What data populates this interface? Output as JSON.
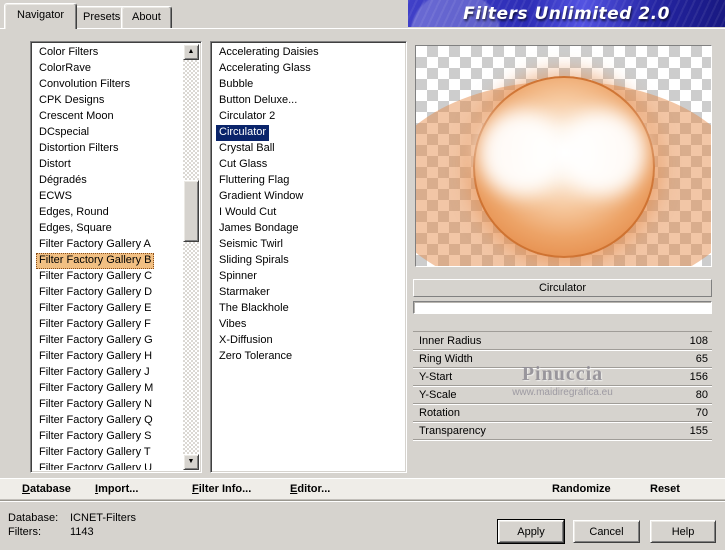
{
  "window": {
    "banner_title": "Filters Unlimited 2.0",
    "tabs": [
      "Navigator",
      "Presets",
      "About"
    ]
  },
  "categories": {
    "selected_index": 13,
    "items": [
      "Color Filters",
      "ColorRave",
      "Convolution Filters",
      "CPK Designs",
      "Crescent Moon",
      "DCspecial",
      "Distortion Filters",
      "Distort",
      "Dégradés",
      "ECWS",
      "Edges, Round",
      "Edges, Square",
      "Filter Factory Gallery A",
      "Filter Factory Gallery B",
      "Filter Factory Gallery C",
      "Filter Factory Gallery D",
      "Filter Factory Gallery E",
      "Filter Factory Gallery F",
      "Filter Factory Gallery G",
      "Filter Factory Gallery H",
      "Filter Factory Gallery J",
      "Filter Factory Gallery M",
      "Filter Factory Gallery N",
      "Filter Factory Gallery Q",
      "Filter Factory Gallery S",
      "Filter Factory Gallery T",
      "Filter Factory Gallery U"
    ]
  },
  "filters_list": {
    "selected_index": 5,
    "items": [
      "Accelerating Daisies",
      "Accelerating Glass",
      "Bubble",
      "Button Deluxe...",
      "Circulator 2",
      "Circulator",
      "Crystal Ball",
      "Cut Glass",
      "Fluttering Flag",
      "Gradient Window",
      "I Would Cut",
      "James Bondage",
      "Seismic Twirl",
      "Sliding Spirals",
      "Spinner",
      "Starmaker",
      "The Blackhole",
      "Vibes",
      "X-Diffusion",
      "Zero Tolerance"
    ]
  },
  "preview": {
    "caption": "Circulator"
  },
  "parameters": [
    {
      "label": "Inner Radius",
      "value": "108"
    },
    {
      "label": "Ring Width",
      "value": "65"
    },
    {
      "label": "Y-Start",
      "value": "156"
    },
    {
      "label": "Y-Scale",
      "value": "80"
    },
    {
      "label": "Rotation",
      "value": "70"
    },
    {
      "label": "Transparency",
      "value": "155"
    }
  ],
  "watermark": {
    "line1": "Pinuccia",
    "line2": "www.maidiregrafica.eu"
  },
  "toolbar": {
    "items": [
      {
        "label": "Database",
        "underline": true
      },
      {
        "label": "Import...",
        "underline": true
      },
      {
        "label": "Filter Info...",
        "underline": true
      },
      {
        "label": "Editor...",
        "underline": true
      },
      {
        "label": "Randomize",
        "underline": false
      },
      {
        "label": "Reset",
        "underline": false
      }
    ]
  },
  "statusbar": {
    "database_label": "Database:",
    "database_value": "ICNET-Filters",
    "filters_label": "Filters:",
    "filters_value": "1143",
    "buttons": {
      "apply": "Apply",
      "cancel": "Cancel",
      "help": "Help"
    }
  },
  "scrollbar": {
    "up": "▲",
    "down": "▼"
  },
  "colors": {
    "selection_blue": "#0a246a",
    "selection_tan": "#f2c083",
    "banner_blue": "#2d2db6",
    "preview_orange": "#e58e4d",
    "chrome_gray": "#d6d3ce"
  }
}
